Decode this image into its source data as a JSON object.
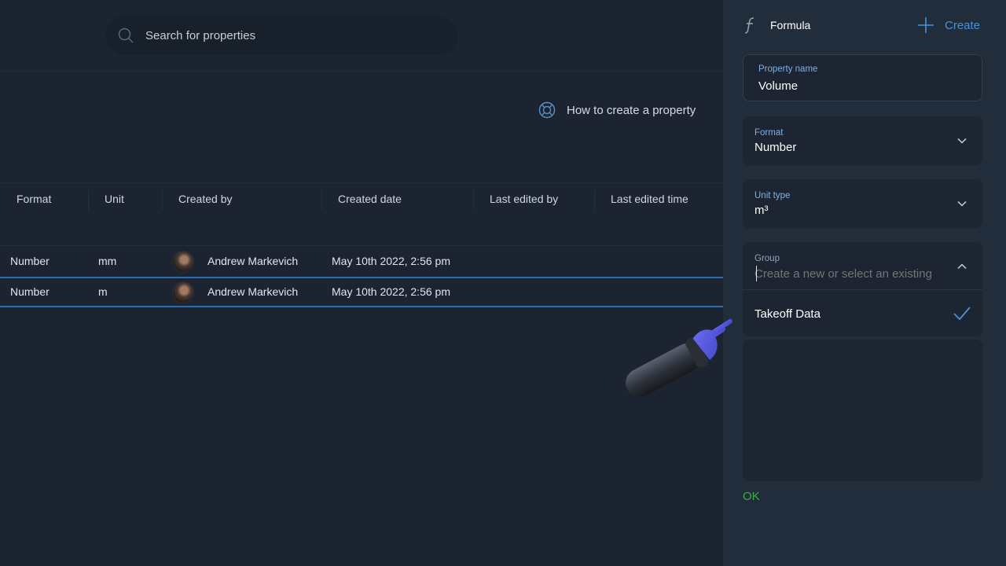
{
  "search": {
    "placeholder": "Search for properties"
  },
  "help": {
    "label": "How to create a property"
  },
  "table": {
    "columns": [
      "Format",
      "Unit",
      "Created by",
      "Created date",
      "Last edited by",
      "Last edited time"
    ],
    "rows": [
      {
        "format": "Number",
        "unit": "mm",
        "created_by": "Andrew Markevich",
        "created_date": "May 10th 2022, 2:56 pm",
        "last_edited_by": "",
        "last_edited_time": ""
      },
      {
        "format": "Number",
        "unit": "m",
        "created_by": "Andrew Markevich",
        "created_date": "May 10th 2022, 2:56 pm",
        "last_edited_by": "",
        "last_edited_time": ""
      }
    ]
  },
  "panel": {
    "header": {
      "title": "Formula",
      "create_label": "Create"
    },
    "property_name": {
      "label": "Property name",
      "value": "Volume"
    },
    "format": {
      "label": "Format",
      "value": "Number"
    },
    "unit_type": {
      "label": "Unit type",
      "value": "m³"
    },
    "group": {
      "label": "Group",
      "placeholder": "Create a new or select an existing",
      "value": ""
    },
    "group_options": [
      {
        "label": "Takeoff Data",
        "selected": true
      }
    ],
    "ok_label": "OK"
  },
  "colors": {
    "accent": "#4a90d9",
    "ok": "#3fae4a",
    "selection": "#2b6cb0"
  }
}
